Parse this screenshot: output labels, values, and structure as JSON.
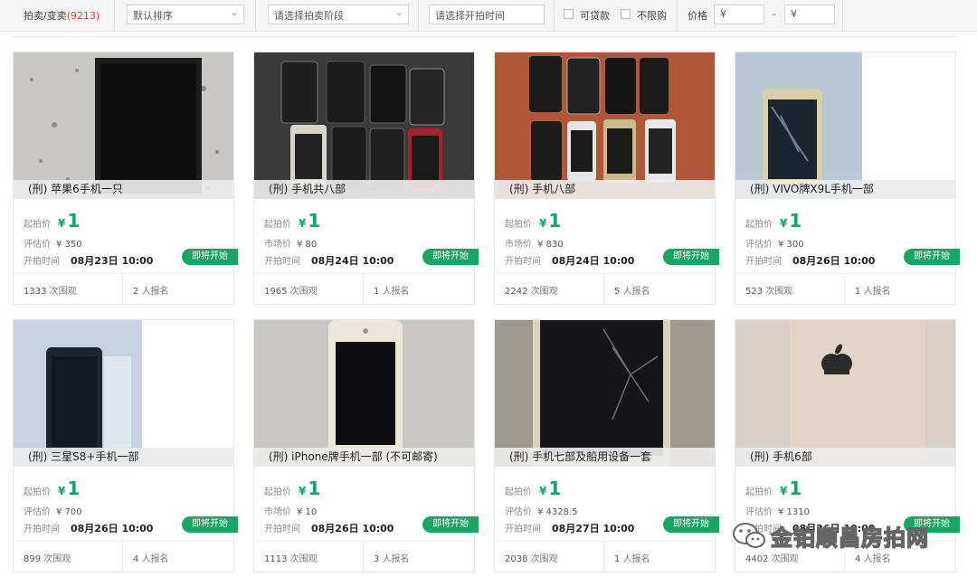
{
  "filters": {
    "auction_label": "拍卖/变卖",
    "auction_count": "(9213)",
    "sort_value": "默认排序",
    "stage_placeholder": "请选择拍卖阶段",
    "time_placeholder": "请选择开拍时间",
    "loan_label": "可贷款",
    "no_limit_label": "不限购",
    "price_label": "价格",
    "price_min": "¥",
    "price_max": "¥",
    "dash": "–"
  },
  "common": {
    "start_price_label": "起拍价",
    "time_label": "开拍时间",
    "yen": "¥",
    "start_button": "即将开始",
    "views_suffix": "次围观",
    "signups_suffix": "人报名"
  },
  "items": [
    {
      "title": "(刑) 苹果6手机一只",
      "start_price": "1",
      "est_label": "评估价",
      "est_value": "¥ 350",
      "start_time": "08月23日 10:00",
      "views": "1333",
      "signups": "2"
    },
    {
      "title": "(刑) 手机共八部",
      "start_price": "1",
      "est_label": "市场价",
      "est_value": "¥ 80",
      "start_time": "08月24日 10:00",
      "views": "1965",
      "signups": "1"
    },
    {
      "title": "(刑) 手机八部",
      "start_price": "1",
      "est_label": "市场价",
      "est_value": "¥ 830",
      "start_time": "08月24日 10:00",
      "views": "2242",
      "signups": "5"
    },
    {
      "title": "(刑) VIVO牌X9L手机一部",
      "start_price": "1",
      "est_label": "评估价",
      "est_value": "¥ 300",
      "start_time": "08月26日 10:00",
      "views": "523",
      "signups": "1"
    },
    {
      "title": "(刑) 三星S8+手机一部",
      "start_price": "1",
      "est_label": "评估价",
      "est_value": "¥ 700",
      "start_time": "08月26日 10:00",
      "views": "899",
      "signups": "4"
    },
    {
      "title": "(刑) iPhone牌手机一部 (不可邮寄)",
      "start_price": "1",
      "est_label": "市场价",
      "est_value": "¥ 10",
      "start_time": "08月26日 10:00",
      "views": "1113",
      "signups": "3"
    },
    {
      "title": "(刑) 手机七部及船用设备一套",
      "start_price": "1",
      "est_label": "评估价",
      "est_value": "¥ 4328.5",
      "start_time": "08月27日 10:00",
      "views": "2038",
      "signups": "1"
    },
    {
      "title": "(刑) 手机6部",
      "start_price": "1",
      "est_label": "评估价",
      "est_value": "¥ 1310",
      "start_time": "08月26日 10:00",
      "views": "4402",
      "signups": "4"
    }
  ],
  "watermark": "金铂顺昌房拍网"
}
